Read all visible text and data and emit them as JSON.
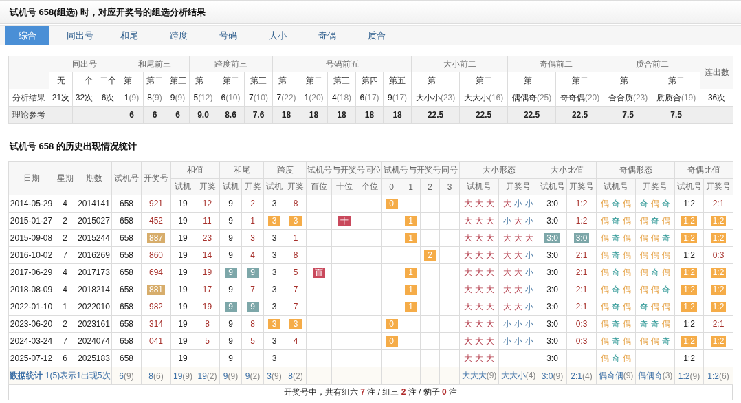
{
  "title": "试机号 658(组选) 时，对应开奖号的组选分析结果",
  "tabs": [
    {
      "label": "综合",
      "selected": true
    },
    {
      "label": "同出号",
      "selected": false
    },
    {
      "label": "和尾",
      "selected": false
    },
    {
      "label": "跨度",
      "selected": false
    },
    {
      "label": "号码",
      "selected": false
    },
    {
      "label": "大小",
      "selected": false
    },
    {
      "label": "奇偶",
      "selected": false
    },
    {
      "label": "质合",
      "selected": false
    }
  ],
  "analysis": {
    "groups": [
      {
        "label": "同出号",
        "sub": [
          "无",
          "一个",
          "二个"
        ]
      },
      {
        "label": "和尾前三",
        "sub": [
          "第一",
          "第二",
          "第三"
        ]
      },
      {
        "label": "跨度前三",
        "sub": [
          "第一",
          "第二",
          "第三"
        ]
      },
      {
        "label": "号码前五",
        "sub": [
          "第一",
          "第二",
          "第三",
          "第四",
          "第五"
        ]
      },
      {
        "label": "大小前二",
        "sub": [
          "第一",
          "第二"
        ]
      },
      {
        "label": "奇偶前二",
        "sub": [
          "第一",
          "第二"
        ]
      },
      {
        "label": "质合前二",
        "sub": [
          "第一",
          "第二"
        ]
      }
    ],
    "last_column": "连出数",
    "rows": [
      {
        "label": "分析结果",
        "kind": "result",
        "cells": [
          {
            "value": "21次"
          },
          {
            "value": "32次"
          },
          {
            "value": "6次"
          },
          {
            "value": "1",
            "count": "(9)"
          },
          {
            "value": "8",
            "count": "(9)"
          },
          {
            "value": "9",
            "count": "(9)"
          },
          {
            "value": "5",
            "count": "(12)"
          },
          {
            "value": "6",
            "count": "(10)"
          },
          {
            "value": "7",
            "count": "(10)"
          },
          {
            "value": "7",
            "count": "(22)"
          },
          {
            "value": "1",
            "count": "(20)"
          },
          {
            "value": "4",
            "count": "(18)"
          },
          {
            "value": "6",
            "count": "(17)"
          },
          {
            "value": "9",
            "count": "(17)"
          },
          {
            "value": "大小小",
            "count": "(23)"
          },
          {
            "value": "大大小",
            "count": "(16)"
          },
          {
            "value": "偶偶奇",
            "count": "(25)"
          },
          {
            "value": "奇奇偶",
            "count": "(20)"
          },
          {
            "value": "合合质",
            "count": "(23)"
          },
          {
            "value": "质质合",
            "count": "(19)"
          },
          {
            "value": "36次"
          }
        ]
      },
      {
        "label": "理论参考",
        "kind": "reference",
        "cells": [
          null,
          null,
          null,
          {
            "value": "6"
          },
          {
            "value": "6"
          },
          {
            "value": "6"
          },
          {
            "value": "9.0"
          },
          {
            "value": "8.6"
          },
          {
            "value": "7.6"
          },
          {
            "value": "18"
          },
          {
            "value": "18"
          },
          {
            "value": "18"
          },
          {
            "value": "18"
          },
          {
            "value": "18"
          },
          {
            "value": "22.5"
          },
          {
            "value": "22.5"
          },
          {
            "value": "22.5"
          },
          {
            "value": "22.5"
          },
          {
            "value": "7.5"
          },
          {
            "value": "7.5"
          },
          null
        ]
      }
    ]
  },
  "history_title": "试机号 658 的历史出现情况统计",
  "history": {
    "columns": [
      {
        "label": "日期"
      },
      {
        "label": "星期"
      },
      {
        "label": "期数"
      },
      {
        "label": "试机号"
      },
      {
        "label": "开奖号"
      },
      {
        "label": "和值",
        "colspan": 2,
        "sub": [
          "试机",
          "开奖"
        ]
      },
      {
        "label": "和尾",
        "colspan": 2,
        "sub": [
          "试机",
          "开奖"
        ]
      },
      {
        "label": "跨度",
        "colspan": 2,
        "sub": [
          "试机",
          "开奖"
        ]
      },
      {
        "label": "试机号与开奖号同位",
        "colspan": 3,
        "sub": [
          "百位",
          "十位",
          "个位"
        ]
      },
      {
        "label": "试机号与开奖号同号",
        "colspan": 4,
        "sub": [
          "0",
          "1",
          "2",
          "3"
        ]
      },
      {
        "label": "大小形态",
        "colspan": 2,
        "sub": [
          "试机号",
          "开奖号"
        ]
      },
      {
        "label": "大小比值",
        "colspan": 2,
        "sub": [
          "试机号",
          "开奖号"
        ]
      },
      {
        "label": "奇偶形态",
        "colspan": 2,
        "sub": [
          "试机号",
          "开奖号"
        ]
      },
      {
        "label": "奇偶比值",
        "colspan": 2,
        "sub": [
          "试机号",
          "开奖号"
        ]
      }
    ],
    "rows": [
      [
        {
          "text": "2014-05-29"
        },
        {
          "text": "4"
        },
        {
          "text": "2014141"
        },
        {
          "text": "658"
        },
        {
          "text": "921",
          "kind": "draw"
        },
        {
          "text": "19"
        },
        {
          "text": "12",
          "kind": "draw"
        },
        {
          "text": "9"
        },
        {
          "text": "2",
          "kind": "draw"
        },
        {
          "text": "3"
        },
        {
          "text": "8",
          "kind": "draw"
        },
        null,
        null,
        null,
        {
          "text": "0",
          "kind": "orange"
        },
        null,
        null,
        null,
        {
          "kind": "shape",
          "chars": [
            {
              "text": "大",
              "kind": "big"
            },
            {
              "text": "大",
              "kind": "big"
            },
            {
              "text": "大",
              "kind": "big"
            }
          ]
        },
        {
          "kind": "shape",
          "chars": [
            {
              "text": "大",
              "kind": "big"
            },
            {
              "text": "小",
              "kind": "small"
            },
            {
              "text": "小",
              "kind": "small"
            }
          ]
        },
        {
          "text": "3:0"
        },
        {
          "text": "1:2",
          "kind": "draw"
        },
        {
          "kind": "shape",
          "chars": [
            {
              "text": "偶",
              "kind": "even"
            },
            {
              "text": "奇",
              "kind": "odd"
            },
            {
              "text": "偶",
              "kind": "even"
            }
          ]
        },
        {
          "kind": "shape",
          "chars": [
            {
              "text": "奇",
              "kind": "odd"
            },
            {
              "text": "偶",
              "kind": "even"
            },
            {
              "text": "奇",
              "kind": "odd"
            }
          ]
        },
        {
          "text": "1:2"
        },
        {
          "text": "2:1",
          "kind": "draw"
        }
      ],
      [
        {
          "text": "2015-01-27"
        },
        {
          "text": "2"
        },
        {
          "text": "2015027"
        },
        {
          "text": "658"
        },
        {
          "text": "452",
          "kind": "draw"
        },
        {
          "text": "19"
        },
        {
          "text": "11",
          "kind": "draw"
        },
        {
          "text": "9"
        },
        {
          "text": "1",
          "kind": "draw"
        },
        {
          "text": "3",
          "kind": "orange"
        },
        {
          "text": "3",
          "kind": "orange"
        },
        null,
        {
          "text": "十",
          "kind": "crimson"
        },
        null,
        null,
        {
          "text": "1",
          "kind": "orange"
        },
        null,
        null,
        {
          "kind": "shape",
          "chars": [
            {
              "text": "大",
              "kind": "big"
            },
            {
              "text": "大",
              "kind": "big"
            },
            {
              "text": "大",
              "kind": "big"
            }
          ]
        },
        {
          "kind": "shape",
          "chars": [
            {
              "text": "小",
              "kind": "small"
            },
            {
              "text": "大",
              "kind": "big"
            },
            {
              "text": "小",
              "kind": "small"
            }
          ]
        },
        {
          "text": "3:0"
        },
        {
          "text": "1:2",
          "kind": "draw"
        },
        {
          "kind": "shape",
          "chars": [
            {
              "text": "偶",
              "kind": "even"
            },
            {
              "text": "奇",
              "kind": "odd"
            },
            {
              "text": "偶",
              "kind": "even"
            }
          ]
        },
        {
          "kind": "shape",
          "chars": [
            {
              "text": "偶",
              "kind": "even"
            },
            {
              "text": "奇",
              "kind": "odd"
            },
            {
              "text": "偶",
              "kind": "even"
            }
          ]
        },
        {
          "text": "1:2",
          "kind": "orange"
        },
        {
          "text": "1:2",
          "kind": "orange"
        }
      ],
      [
        {
          "text": "2015-09-08"
        },
        {
          "text": "2"
        },
        {
          "text": "2015244"
        },
        {
          "text": "658"
        },
        {
          "text": "887",
          "kind": "tan"
        },
        {
          "text": "19"
        },
        {
          "text": "23",
          "kind": "draw"
        },
        {
          "text": "9"
        },
        {
          "text": "3",
          "kind": "draw"
        },
        {
          "text": "3"
        },
        {
          "text": "1",
          "kind": "draw"
        },
        null,
        null,
        null,
        null,
        {
          "text": "1",
          "kind": "orange"
        },
        null,
        null,
        {
          "kind": "shape",
          "chars": [
            {
              "text": "大",
              "kind": "big"
            },
            {
              "text": "大",
              "kind": "big"
            },
            {
              "text": "大",
              "kind": "big"
            }
          ]
        },
        {
          "kind": "shape",
          "chars": [
            {
              "text": "大",
              "kind": "big"
            },
            {
              "text": "大",
              "kind": "big"
            },
            {
              "text": "大",
              "kind": "big"
            }
          ]
        },
        {
          "text": "3:0",
          "kind": "teal"
        },
        {
          "text": "3:0",
          "kind": "teal"
        },
        {
          "kind": "shape",
          "chars": [
            {
              "text": "偶",
              "kind": "even"
            },
            {
              "text": "奇",
              "kind": "odd"
            },
            {
              "text": "偶",
              "kind": "even"
            }
          ]
        },
        {
          "kind": "shape",
          "chars": [
            {
              "text": "偶",
              "kind": "even"
            },
            {
              "text": "偶",
              "kind": "even"
            },
            {
              "text": "奇",
              "kind": "odd"
            }
          ]
        },
        {
          "text": "1:2",
          "kind": "orange"
        },
        {
          "text": "1:2",
          "kind": "orange"
        }
      ],
      [
        {
          "text": "2016-10-02"
        },
        {
          "text": "7"
        },
        {
          "text": "2016269"
        },
        {
          "text": "658"
        },
        {
          "text": "860",
          "kind": "draw"
        },
        {
          "text": "19"
        },
        {
          "text": "14",
          "kind": "draw"
        },
        {
          "text": "9"
        },
        {
          "text": "4",
          "kind": "draw"
        },
        {
          "text": "3"
        },
        {
          "text": "8",
          "kind": "draw"
        },
        null,
        null,
        null,
        null,
        null,
        {
          "text": "2",
          "kind": "orange"
        },
        null,
        {
          "kind": "shape",
          "chars": [
            {
              "text": "大",
              "kind": "big"
            },
            {
              "text": "大",
              "kind": "big"
            },
            {
              "text": "大",
              "kind": "big"
            }
          ]
        },
        {
          "kind": "shape",
          "chars": [
            {
              "text": "大",
              "kind": "big"
            },
            {
              "text": "大",
              "kind": "big"
            },
            {
              "text": "小",
              "kind": "small"
            }
          ]
        },
        {
          "text": "3:0"
        },
        {
          "text": "2:1",
          "kind": "draw"
        },
        {
          "kind": "shape",
          "chars": [
            {
              "text": "偶",
              "kind": "even"
            },
            {
              "text": "奇",
              "kind": "odd"
            },
            {
              "text": "偶",
              "kind": "even"
            }
          ]
        },
        {
          "kind": "shape",
          "chars": [
            {
              "text": "偶",
              "kind": "even"
            },
            {
              "text": "偶",
              "kind": "even"
            },
            {
              "text": "偶",
              "kind": "even"
            }
          ]
        },
        {
          "text": "1:2"
        },
        {
          "text": "0:3",
          "kind": "draw"
        }
      ],
      [
        {
          "text": "2017-06-29"
        },
        {
          "text": "4"
        },
        {
          "text": "2017173"
        },
        {
          "text": "658"
        },
        {
          "text": "694",
          "kind": "draw"
        },
        {
          "text": "19"
        },
        {
          "text": "19",
          "kind": "draw"
        },
        {
          "text": "9",
          "kind": "teal"
        },
        {
          "text": "9",
          "kind": "teal"
        },
        {
          "text": "3"
        },
        {
          "text": "5",
          "kind": "draw"
        },
        {
          "text": "百",
          "kind": "crimson"
        },
        null,
        null,
        null,
        {
          "text": "1",
          "kind": "orange"
        },
        null,
        null,
        {
          "kind": "shape",
          "chars": [
            {
              "text": "大",
              "kind": "big"
            },
            {
              "text": "大",
              "kind": "big"
            },
            {
              "text": "大",
              "kind": "big"
            }
          ]
        },
        {
          "kind": "shape",
          "chars": [
            {
              "text": "大",
              "kind": "big"
            },
            {
              "text": "大",
              "kind": "big"
            },
            {
              "text": "小",
              "kind": "small"
            }
          ]
        },
        {
          "text": "3:0"
        },
        {
          "text": "2:1",
          "kind": "draw"
        },
        {
          "kind": "shape",
          "chars": [
            {
              "text": "偶",
              "kind": "even"
            },
            {
              "text": "奇",
              "kind": "odd"
            },
            {
              "text": "偶",
              "kind": "even"
            }
          ]
        },
        {
          "kind": "shape",
          "chars": [
            {
              "text": "偶",
              "kind": "even"
            },
            {
              "text": "奇",
              "kind": "odd"
            },
            {
              "text": "偶",
              "kind": "even"
            }
          ]
        },
        {
          "text": "1:2",
          "kind": "orange"
        },
        {
          "text": "1:2",
          "kind": "orange"
        }
      ],
      [
        {
          "text": "2018-08-09"
        },
        {
          "text": "4"
        },
        {
          "text": "2018214"
        },
        {
          "text": "658"
        },
        {
          "text": "881",
          "kind": "tan"
        },
        {
          "text": "19"
        },
        {
          "text": "17",
          "kind": "draw"
        },
        {
          "text": "9"
        },
        {
          "text": "7",
          "kind": "draw"
        },
        {
          "text": "3"
        },
        {
          "text": "7",
          "kind": "draw"
        },
        null,
        null,
        null,
        null,
        {
          "text": "1",
          "kind": "orange"
        },
        null,
        null,
        {
          "kind": "shape",
          "chars": [
            {
              "text": "大",
              "kind": "big"
            },
            {
              "text": "大",
              "kind": "big"
            },
            {
              "text": "大",
              "kind": "big"
            }
          ]
        },
        {
          "kind": "shape",
          "chars": [
            {
              "text": "大",
              "kind": "big"
            },
            {
              "text": "大",
              "kind": "big"
            },
            {
              "text": "小",
              "kind": "small"
            }
          ]
        },
        {
          "text": "3:0"
        },
        {
          "text": "2:1",
          "kind": "draw"
        },
        {
          "kind": "shape",
          "chars": [
            {
              "text": "偶",
              "kind": "even"
            },
            {
              "text": "奇",
              "kind": "odd"
            },
            {
              "text": "偶",
              "kind": "even"
            }
          ]
        },
        {
          "kind": "shape",
          "chars": [
            {
              "text": "偶",
              "kind": "even"
            },
            {
              "text": "偶",
              "kind": "even"
            },
            {
              "text": "奇",
              "kind": "odd"
            }
          ]
        },
        {
          "text": "1:2",
          "kind": "orange"
        },
        {
          "text": "1:2",
          "kind": "orange"
        }
      ],
      [
        {
          "text": "2022-01-10"
        },
        {
          "text": "1"
        },
        {
          "text": "2022010"
        },
        {
          "text": "658"
        },
        {
          "text": "982",
          "kind": "draw"
        },
        {
          "text": "19"
        },
        {
          "text": "19",
          "kind": "draw"
        },
        {
          "text": "9",
          "kind": "teal"
        },
        {
          "text": "9",
          "kind": "teal"
        },
        {
          "text": "3"
        },
        {
          "text": "7",
          "kind": "draw"
        },
        null,
        null,
        null,
        null,
        {
          "text": "1",
          "kind": "orange"
        },
        null,
        null,
        {
          "kind": "shape",
          "chars": [
            {
              "text": "大",
              "kind": "big"
            },
            {
              "text": "大",
              "kind": "big"
            },
            {
              "text": "大",
              "kind": "big"
            }
          ]
        },
        {
          "kind": "shape",
          "chars": [
            {
              "text": "大",
              "kind": "big"
            },
            {
              "text": "大",
              "kind": "big"
            },
            {
              "text": "小",
              "kind": "small"
            }
          ]
        },
        {
          "text": "3:0"
        },
        {
          "text": "2:1",
          "kind": "draw"
        },
        {
          "kind": "shape",
          "chars": [
            {
              "text": "偶",
              "kind": "even"
            },
            {
              "text": "奇",
              "kind": "odd"
            },
            {
              "text": "偶",
              "kind": "even"
            }
          ]
        },
        {
          "kind": "shape",
          "chars": [
            {
              "text": "奇",
              "kind": "odd"
            },
            {
              "text": "偶",
              "kind": "even"
            },
            {
              "text": "偶",
              "kind": "even"
            }
          ]
        },
        {
          "text": "1:2",
          "kind": "orange"
        },
        {
          "text": "1:2",
          "kind": "orange"
        }
      ],
      [
        {
          "text": "2023-06-20"
        },
        {
          "text": "2"
        },
        {
          "text": "2023161"
        },
        {
          "text": "658"
        },
        {
          "text": "314",
          "kind": "draw"
        },
        {
          "text": "19"
        },
        {
          "text": "8",
          "kind": "draw"
        },
        {
          "text": "9"
        },
        {
          "text": "8",
          "kind": "draw"
        },
        {
          "text": "3",
          "kind": "orange"
        },
        {
          "text": "3",
          "kind": "orange"
        },
        null,
        null,
        null,
        {
          "text": "0",
          "kind": "orange"
        },
        null,
        null,
        null,
        {
          "kind": "shape",
          "chars": [
            {
              "text": "大",
              "kind": "big"
            },
            {
              "text": "大",
              "kind": "big"
            },
            {
              "text": "大",
              "kind": "big"
            }
          ]
        },
        {
          "kind": "shape",
          "chars": [
            {
              "text": "小",
              "kind": "small"
            },
            {
              "text": "小",
              "kind": "small"
            },
            {
              "text": "小",
              "kind": "small"
            }
          ]
        },
        {
          "text": "3:0"
        },
        {
          "text": "0:3",
          "kind": "draw"
        },
        {
          "kind": "shape",
          "chars": [
            {
              "text": "偶",
              "kind": "even"
            },
            {
              "text": "奇",
              "kind": "odd"
            },
            {
              "text": "偶",
              "kind": "even"
            }
          ]
        },
        {
          "kind": "shape",
          "chars": [
            {
              "text": "奇",
              "kind": "odd"
            },
            {
              "text": "奇",
              "kind": "odd"
            },
            {
              "text": "偶",
              "kind": "even"
            }
          ]
        },
        {
          "text": "1:2"
        },
        {
          "text": "2:1",
          "kind": "draw"
        }
      ],
      [
        {
          "text": "2024-03-24"
        },
        {
          "text": "7"
        },
        {
          "text": "2024074"
        },
        {
          "text": "658"
        },
        {
          "text": "041",
          "kind": "draw"
        },
        {
          "text": "19"
        },
        {
          "text": "5",
          "kind": "draw"
        },
        {
          "text": "9"
        },
        {
          "text": "5",
          "kind": "draw"
        },
        {
          "text": "3"
        },
        {
          "text": "4",
          "kind": "draw"
        },
        null,
        null,
        null,
        {
          "text": "0",
          "kind": "orange"
        },
        null,
        null,
        null,
        {
          "kind": "shape",
          "chars": [
            {
              "text": "大",
              "kind": "big"
            },
            {
              "text": "大",
              "kind": "big"
            },
            {
              "text": "大",
              "kind": "big"
            }
          ]
        },
        {
          "kind": "shape",
          "chars": [
            {
              "text": "小",
              "kind": "small"
            },
            {
              "text": "小",
              "kind": "small"
            },
            {
              "text": "小",
              "kind": "small"
            }
          ]
        },
        {
          "text": "3:0"
        },
        {
          "text": "0:3",
          "kind": "draw"
        },
        {
          "kind": "shape",
          "chars": [
            {
              "text": "偶",
              "kind": "even"
            },
            {
              "text": "奇",
              "kind": "odd"
            },
            {
              "text": "偶",
              "kind": "even"
            }
          ]
        },
        {
          "kind": "shape",
          "chars": [
            {
              "text": "偶",
              "kind": "even"
            },
            {
              "text": "偶",
              "kind": "even"
            },
            {
              "text": "奇",
              "kind": "odd"
            }
          ]
        },
        {
          "text": "1:2",
          "kind": "orange"
        },
        {
          "text": "1:2",
          "kind": "orange"
        }
      ],
      [
        {
          "text": "2025-07-12"
        },
        {
          "text": "6"
        },
        {
          "text": "2025183"
        },
        {
          "text": "658"
        },
        null,
        {
          "text": "19"
        },
        null,
        {
          "text": "9"
        },
        null,
        {
          "text": "3"
        },
        null,
        null,
        null,
        null,
        null,
        null,
        null,
        null,
        {
          "kind": "shape",
          "chars": [
            {
              "text": "大",
              "kind": "big"
            },
            {
              "text": "大",
              "kind": "big"
            },
            {
              "text": "大",
              "kind": "big"
            }
          ]
        },
        null,
        {
          "text": "3:0"
        },
        null,
        {
          "kind": "shape",
          "chars": [
            {
              "text": "偶",
              "kind": "even"
            },
            {
              "text": "奇",
              "kind": "odd"
            },
            {
              "text": "偶",
              "kind": "even"
            }
          ]
        },
        null,
        {
          "text": "1:2"
        },
        null
      ]
    ],
    "stats": {
      "title": "数据统计",
      "note": "1(5)表示1出现5次",
      "cells": [
        {
          "value": "6",
          "count": "(9)"
        },
        {
          "value": "8",
          "count": "(6)"
        },
        {
          "value": "19",
          "count": "(9)"
        },
        {
          "value": "19",
          "count": "(2)"
        },
        {
          "value": "9",
          "count": "(9)"
        },
        {
          "value": "9",
          "count": "(2)"
        },
        {
          "value": "3",
          "count": "(9)"
        },
        {
          "value": "8",
          "count": "(2)"
        },
        null,
        null,
        null,
        null,
        null,
        null,
        null,
        {
          "value": "大大大",
          "count": "(9)"
        },
        {
          "value": "大大小",
          "count": "(4)"
        },
        {
          "value": "3:0",
          "count": "(9)"
        },
        {
          "value": "2:1",
          "count": "(4)"
        },
        {
          "value": "偶奇偶",
          "count": "(9)"
        },
        {
          "value": "偶偶奇",
          "count": "(3)"
        },
        {
          "value": "1:2",
          "count": "(9)"
        },
        {
          "value": "1:2",
          "count": "(6)"
        }
      ]
    },
    "summary": "开奖号中，共有组六 **7** 注 / 组三 **2** 注 / 豹子 **0** 注"
  }
}
